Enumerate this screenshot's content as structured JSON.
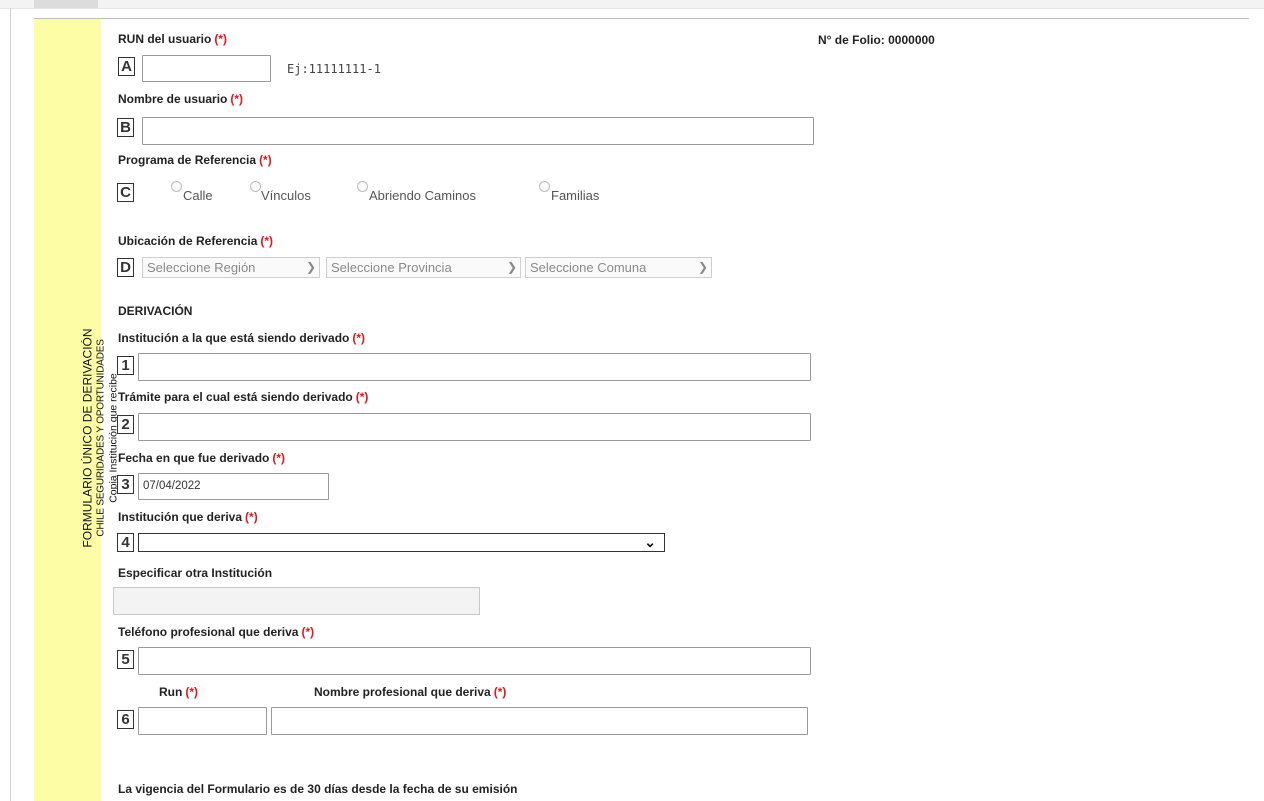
{
  "sidebar": {
    "line1": "FORMULARIO ÚNICO DE DERIVACIÓN",
    "line2": "CHILE SEGURIDADES Y OPORTUNIDADES",
    "line3": "Copia Institución que recibe"
  },
  "folio": {
    "label": "N° de Folio: 0000000"
  },
  "required_mark": "(*)",
  "fields": {
    "run": {
      "badge": "A",
      "label": "RUN del usuario",
      "value": "",
      "hint": "Ej:11111111-1"
    },
    "nombre": {
      "badge": "B",
      "label": "Nombre de usuario",
      "value": ""
    },
    "programa": {
      "badge": "C",
      "label": "Programa de Referencia",
      "options": [
        "Calle",
        "Vínculos",
        "Abriendo Caminos",
        "Familias"
      ]
    },
    "ubicacion": {
      "badge": "D",
      "label": "Ubicación de Referencia",
      "region": "Seleccione Región",
      "provincia": "Seleccione Provincia",
      "comuna": "Seleccione Comuna"
    }
  },
  "derivacion": {
    "title": "DERIVACIÓN",
    "institucion": {
      "badge": "1",
      "label": "Institución a la que está siendo derivado",
      "value": ""
    },
    "tramite": {
      "badge": "2",
      "label": "Trámite para el cual está siendo derivado",
      "value": ""
    },
    "fecha": {
      "badge": "3",
      "label": "Fecha en que fue derivado",
      "value": "07/04/2022"
    },
    "institucion_deriva": {
      "badge": "4",
      "label": "Institución que deriva",
      "value": ""
    },
    "otra_institucion": {
      "label": "Especificar otra Institución",
      "value": ""
    },
    "telefono": {
      "badge": "5",
      "label": "Teléfono profesional que deriva",
      "value": ""
    },
    "profesional": {
      "badge": "6",
      "run_label": "Run",
      "nombre_label": "Nombre profesional que deriva",
      "run_value": "",
      "nombre_value": ""
    }
  },
  "footer": {
    "note": "La vigencia del Formulario es de 30 días desde la fecha de su emisión"
  },
  "icons": {
    "chevron": "chevron-down-icon"
  },
  "colors": {
    "sidebar_bg": "#fdfda6",
    "required": "#e0161e"
  }
}
